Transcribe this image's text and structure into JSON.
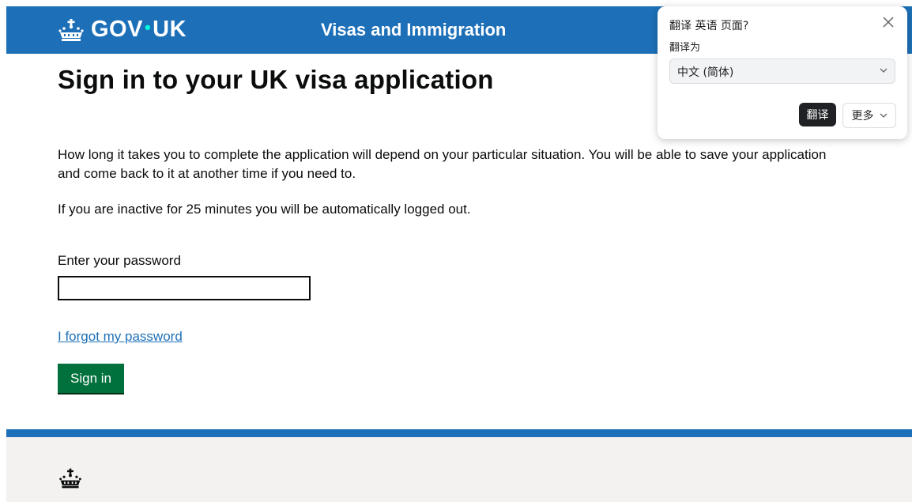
{
  "header": {
    "logo_text": "GOV",
    "logo_dot": "•",
    "logo_suffix": "UK",
    "service_name": "Visas and Immigration"
  },
  "main": {
    "title": "Sign in to your UK visa application",
    "paragraph1": "How long it takes you to complete the application will depend on your particular situation. You will be able to save your application and come back to it at another time if you need to.",
    "paragraph2": "If you are inactive for 25 minutes you will be automatically logged out.",
    "password_label": "Enter your password",
    "password_value": "",
    "forgot_link": "I forgot my password",
    "signin_button": "Sign in"
  },
  "translate_popup": {
    "title": "翻译 英语 页面?",
    "translate_to_label": "翻译为",
    "language_selected": "中文 (简体)",
    "translate_button": "翻译",
    "more_button": "更多"
  },
  "icons": {
    "crown": "crown-icon",
    "close": "close-icon",
    "chevron": "chevron-down-icon"
  },
  "colors": {
    "header_blue": "#1d70b8",
    "button_green": "#00703c",
    "link_blue": "#1d70b8",
    "footer_bg": "#f3f2f1"
  }
}
